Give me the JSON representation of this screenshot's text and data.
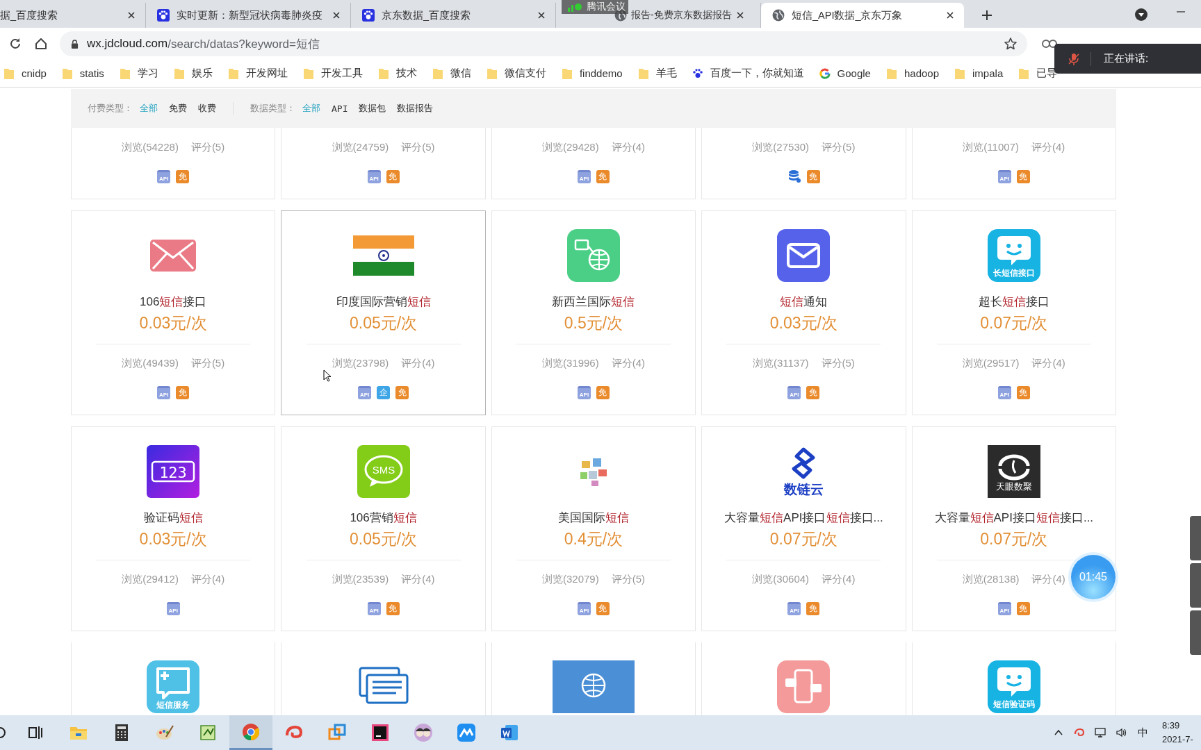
{
  "browser": {
    "tabs": [
      {
        "title": "据_百度搜索",
        "selected": false
      },
      {
        "title": "实时更新：新型冠状病毒肺炎疫",
        "kind": "paw",
        "selected": false
      },
      {
        "title": "京东数据_百度搜索",
        "kind": "paw",
        "selected": false
      },
      {
        "title": "报告-免费京东数据报告",
        "kind": "globe",
        "selected": false
      },
      {
        "title": "短信_API数据_京东万象",
        "kind": "globe",
        "selected": true
      }
    ],
    "url_host": "wx.jdcloud.com",
    "url_path": "/search/datas?keyword=短信",
    "bookmarks": [
      {
        "label": "cnidp",
        "kind": "folder"
      },
      {
        "label": "statis",
        "kind": "folder"
      },
      {
        "label": "学习",
        "kind": "folder"
      },
      {
        "label": "娱乐",
        "kind": "folder"
      },
      {
        "label": "开发网址",
        "kind": "folder"
      },
      {
        "label": "开发工具",
        "kind": "folder"
      },
      {
        "label": "技术",
        "kind": "folder"
      },
      {
        "label": "微信",
        "kind": "folder"
      },
      {
        "label": "微信支付",
        "kind": "folder"
      },
      {
        "label": "finddemo",
        "kind": "folder"
      },
      {
        "label": "羊毛",
        "kind": "folder"
      },
      {
        "label": "百度一下，你就知道",
        "kind": "paw"
      },
      {
        "label": "Google",
        "kind": "ring"
      },
      {
        "label": "hadoop",
        "kind": "folder"
      },
      {
        "label": "impala",
        "kind": "folder"
      },
      {
        "label": "已导",
        "kind": "folder"
      }
    ]
  },
  "filters": [
    {
      "label": "付费类型：",
      "options": [
        {
          "label": "全部",
          "selected": true
        },
        {
          "label": "免费",
          "selected": false
        },
        {
          "label": "收费",
          "selected": false
        }
      ]
    },
    {
      "label": "数据类型：",
      "options": [
        {
          "label": "全部",
          "selected": true
        },
        {
          "label": "API",
          "selected": false
        },
        {
          "label": "数据包",
          "selected": false
        },
        {
          "label": "数据报告",
          "selected": false
        }
      ]
    }
  ],
  "cards": [
    {
      "hovered": false,
      "views": "浏览(54228)",
      "rating": "评分(5)",
      "badges": [
        {
          "kind": "api",
          "text": "API"
        },
        {
          "kind": "free",
          "text": "免"
        }
      ]
    },
    {
      "hovered": false,
      "views": "浏览(24759)",
      "rating": "评分(5)",
      "badges": [
        {
          "kind": "api",
          "text": "API"
        },
        {
          "kind": "free",
          "text": "免"
        }
      ]
    },
    {
      "hovered": false,
      "views": "浏览(29428)",
      "rating": "评分(4)",
      "badges": [
        {
          "kind": "api",
          "text": "API"
        },
        {
          "kind": "free",
          "text": "免"
        }
      ]
    },
    {
      "hovered": false,
      "views": "浏览(27530)",
      "rating": "评分(5)",
      "badges": [
        {
          "kind": "db"
        },
        {
          "kind": "free",
          "text": "免"
        }
      ]
    },
    {
      "hovered": false,
      "views": "浏览(11007)",
      "rating": "评分(4)",
      "badges": [
        {
          "kind": "api",
          "text": "API"
        },
        {
          "kind": "free",
          "text": "免"
        }
      ]
    },
    {
      "hovered": false,
      "icon": {
        "kind": "envelope"
      },
      "title": "106**短信**接口",
      "price": "0.03元/次",
      "views": "浏览(49439)",
      "rating": "评分(5)",
      "badges": [
        {
          "kind": "api",
          "text": "API"
        },
        {
          "kind": "free",
          "text": "免"
        }
      ]
    },
    {
      "hovered": true,
      "icon": {
        "kind": "flag"
      },
      "title": "印度国际营销**短信**",
      "price": "0.05元/次",
      "views": "浏览(23798)",
      "rating": "评分(4)",
      "badges": [
        {
          "kind": "api",
          "text": "API"
        },
        {
          "kind": "ent",
          "text": "企"
        },
        {
          "kind": "free",
          "text": "免"
        }
      ]
    },
    {
      "hovered": false,
      "icon": {
        "kind": "globe"
      },
      "title": "新西兰国际**短信**",
      "price": "0.5元/次",
      "views": "浏览(31996)",
      "rating": "评分(4)",
      "badges": [
        {
          "kind": "api",
          "text": "API"
        },
        {
          "kind": "free",
          "text": "免"
        }
      ]
    },
    {
      "hovered": false,
      "icon": {
        "kind": "mail"
      },
      "title": "**短信**通知",
      "price": "0.03元/次",
      "views": "浏览(31137)",
      "rating": "评分(5)",
      "badges": [
        {
          "kind": "api",
          "text": "API"
        },
        {
          "kind": "free",
          "text": "免"
        }
      ]
    },
    {
      "hovered": false,
      "icon": {
        "kind": "bubble",
        "text": "长短信接口"
      },
      "title": "超长**短信**接口",
      "price": "0.07元/次",
      "views": "浏览(29517)",
      "rating": "评分(4)",
      "badges": [
        {
          "kind": "api",
          "text": "API"
        },
        {
          "kind": "free",
          "text": "免"
        }
      ]
    },
    {
      "hovered": false,
      "icon": {
        "kind": "code",
        "text": "123"
      },
      "title": "验证码**短信**",
      "price": "0.03元/次",
      "views": "浏览(29412)",
      "rating": "评分(4)",
      "badges": [
        {
          "kind": "api",
          "text": "API"
        }
      ]
    },
    {
      "hovered": false,
      "icon": {
        "kind": "sms",
        "text": "SMS"
      },
      "title": "106营销**短信**",
      "price": "0.05元/次",
      "views": "浏览(23539)",
      "rating": "评分(4)",
      "badges": [
        {
          "kind": "api",
          "text": "API"
        },
        {
          "kind": "free",
          "text": "免"
        }
      ]
    },
    {
      "hovered": false,
      "icon": {
        "kind": "tiles"
      },
      "title": "美国国际**短信**",
      "price": "0.4元/次",
      "views": "浏览(32079)",
      "rating": "评分(5)",
      "badges": [
        {
          "kind": "api",
          "text": "API"
        },
        {
          "kind": "free",
          "text": "免"
        }
      ]
    },
    {
      "hovered": false,
      "icon": {
        "kind": "diamond",
        "text": "数链云"
      },
      "title": "大容量**短信**API接口**短信**接口...",
      "price": "0.07元/次",
      "views": "浏览(30604)",
      "rating": "评分(4)",
      "badges": [
        {
          "kind": "api",
          "text": "API"
        },
        {
          "kind": "free",
          "text": "免"
        }
      ]
    },
    {
      "hovered": false,
      "icon": {
        "kind": "eye",
        "text": "天眼数聚"
      },
      "title": "大容量**短信**API接口**短信**接口...",
      "price": "0.07元/次",
      "views": "浏览(28138)",
      "rating": "评分(4)",
      "badges": [
        {
          "kind": "api",
          "text": "API"
        },
        {
          "kind": "free",
          "text": "免"
        }
      ]
    },
    {
      "hovered": false,
      "icon": {
        "kind": "bubble-plus",
        "text": "短信服务"
      }
    },
    {
      "hovered": false,
      "icon": {
        "kind": "document"
      }
    },
    {
      "hovered": false,
      "icon": {
        "kind": "emblem"
      }
    },
    {
      "hovered": false,
      "icon": {
        "kind": "phone"
      }
    },
    {
      "hovered": false,
      "icon": {
        "kind": "bubble",
        "text": "短信验证码"
      }
    }
  ],
  "taskbar": {
    "apps": [
      {
        "kind": "search",
        "active": false
      },
      {
        "kind": "taskview",
        "active": false
      },
      {
        "kind": "folder",
        "active": false
      },
      {
        "kind": "calculator",
        "active": false
      },
      {
        "kind": "palette",
        "active": false
      },
      {
        "kind": "notepad",
        "active": false
      },
      {
        "kind": "browser",
        "active": true
      },
      {
        "kind": "swirl",
        "active": false
      },
      {
        "kind": "squares",
        "active": false
      },
      {
        "kind": "ide",
        "active": false
      },
      {
        "kind": "avatar",
        "active": false
      },
      {
        "kind": "wave",
        "active": false
      },
      {
        "kind": "doc",
        "active": false
      }
    ],
    "ime": "中",
    "time": "8:39",
    "date": "2021-7-"
  },
  "meeting": {
    "label": "腾讯会议"
  },
  "speaking": {
    "label": "正在讲话:"
  },
  "timer": "01:45"
}
